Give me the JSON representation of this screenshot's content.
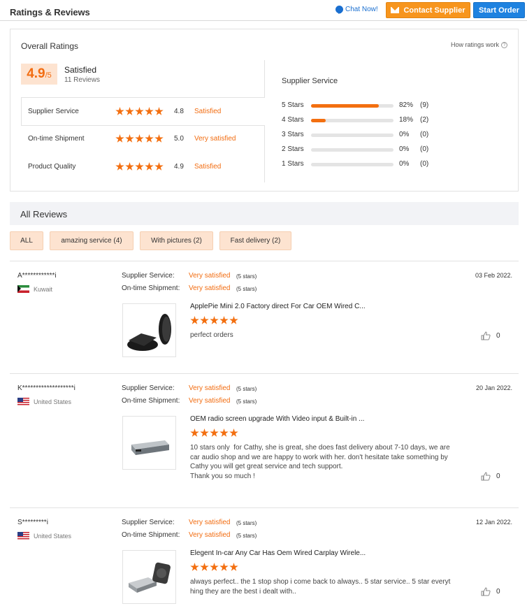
{
  "header": {
    "title": "Ratings & Reviews",
    "chat_label": "Chat Now!",
    "contact_label": "Contact Supplier",
    "order_label": "Start Order"
  },
  "overall": {
    "title": "Overall Ratings",
    "how_label": "How ratings work",
    "score": "4.9",
    "score_suffix": "/5",
    "status": "Satisfied",
    "review_count": "11 Reviews",
    "categories": [
      {
        "name": "Supplier Service",
        "rating": "4.8",
        "stars": 5,
        "label": "Satisfied"
      },
      {
        "name": "On-time Shipment",
        "rating": "5.0",
        "stars": 5,
        "label": "Very satisfied"
      },
      {
        "name": "Product Quality",
        "rating": "4.9",
        "stars": 5,
        "label": "Satisfied"
      }
    ]
  },
  "breakdown": {
    "title": "Supplier Service",
    "rows": [
      {
        "label": "5  Stars",
        "fraction": 0.82,
        "pct": "82%",
        "count": "(9)"
      },
      {
        "label": "4  Stars",
        "fraction": 0.18,
        "pct": "18%",
        "count": "(2)"
      },
      {
        "label": "3  Stars",
        "fraction": 0,
        "pct": "0%",
        "count": "(0)"
      },
      {
        "label": "2  Stars",
        "fraction": 0,
        "pct": "0%",
        "count": "(0)"
      },
      {
        "label": "1  Stars",
        "fraction": 0,
        "pct": "0%",
        "count": "(0)"
      }
    ]
  },
  "all_reviews": {
    "title": "All Reviews",
    "filters": [
      "ALL",
      "amazing service (4)",
      "With pictures (2)",
      "Fast delivery (2)"
    ]
  },
  "reviews": [
    {
      "user": "A************i",
      "country": "Kuwait",
      "flag": "kw",
      "date": "03 Feb 2022.",
      "service_label": "Supplier Service:",
      "service_value": "Very satisfied",
      "service_stars": "(5 stars)",
      "shipment_label": "On-time Shipment:",
      "shipment_value": "Very satisfied",
      "shipment_stars": "(5 stars)",
      "product": "ApplePie Mini 2.0 Factory direct For Car OEM Wired C...",
      "product_stars": 5,
      "text": "perfect orders",
      "likes": "0"
    },
    {
      "user": "K*******************i",
      "country": "United States",
      "flag": "us",
      "date": "20 Jan 2022.",
      "service_label": "Supplier Service:",
      "service_value": "Very satisfied",
      "service_stars": "(5 stars)",
      "shipment_label": "On-time Shipment:",
      "shipment_value": "Very satisfied",
      "shipment_stars": "(5 stars)",
      "product": "OEM radio screen upgrade With Video input & Built-in ...",
      "product_stars": 5,
      "text": "10 stars only  for Cathy, she is great, she does fast delivery about 7-10 days, we are car audio shop and we are happy to work with her. don't hesitate take something by Cathy you will get great service and tech support.\nThank you so much !",
      "likes": "0"
    },
    {
      "user": "S*********i",
      "country": "United States",
      "flag": "us",
      "date": "12 Jan 2022.",
      "service_label": "Supplier Service:",
      "service_value": "Very satisfied",
      "service_stars": "(5 stars)",
      "shipment_label": "On-time Shipment:",
      "shipment_value": "Very satisfied",
      "shipment_stars": "(5 stars)",
      "product": "Elegent In-car Any Car Has Oem Wired Carplay Wirele...",
      "product_stars": 5,
      "text": "always perfect.. the 1 stop shop i come back to always.. 5 star service.. 5 star everything they are the best i dealt with..",
      "likes": "0"
    }
  ],
  "colors": {
    "accent": "#f36f10",
    "contact": "#f7951d",
    "order": "#1e82e0",
    "chip_bg": "#fde3d0"
  }
}
